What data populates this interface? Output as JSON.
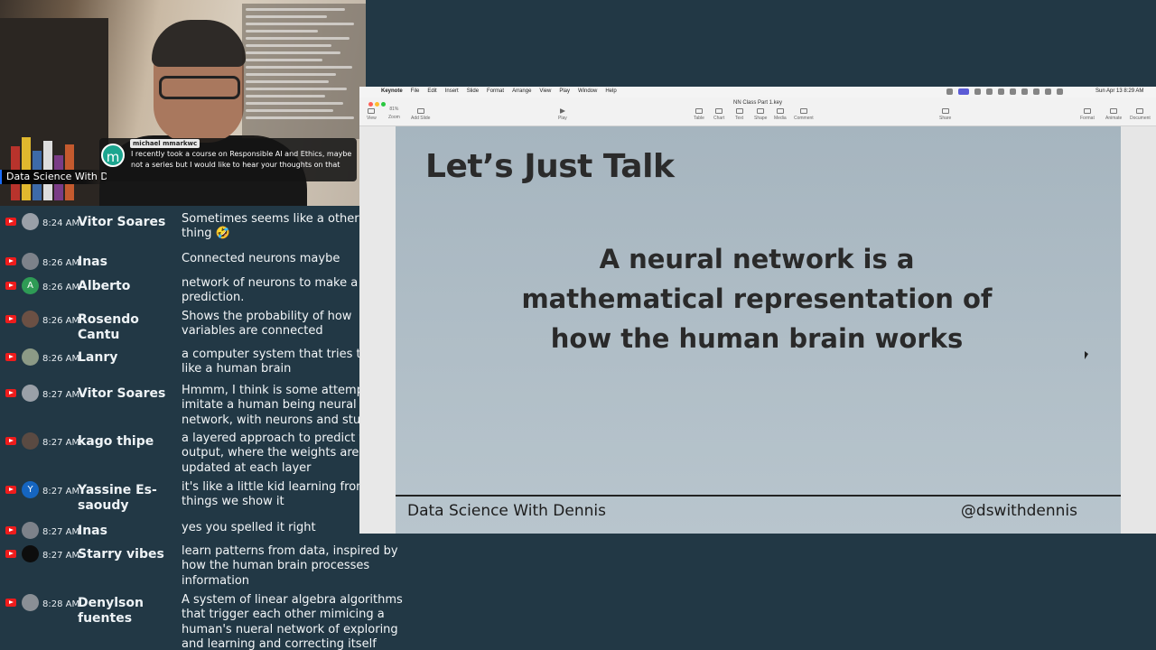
{
  "webcam": {
    "featured_message": {
      "avatar_letter": "m",
      "name": "michael mmarkwc",
      "text": "I recently took a course on Responsible AI and Ethics, maybe not a series but I would like to hear your thoughts on that"
    },
    "channel_banner": "Data Science With De"
  },
  "chat": {
    "messages": [
      {
        "time": "8:24 AM",
        "name": "Vitor Soares",
        "text": "Sometimes seems like a other world thing 🤣",
        "avatar": "",
        "avatar_color": "#9aa0a8"
      },
      {
        "time": "8:26 AM",
        "name": "Inas",
        "text": "Connected neurons maybe",
        "avatar": "",
        "avatar_color": "#7d828a"
      },
      {
        "time": "8:26 AM",
        "name": "Alberto",
        "text": "network of neurons to make a prediction.",
        "avatar": "A",
        "avatar_color": "#2e9b55"
      },
      {
        "time": "8:26 AM",
        "name": "Rosendo Cantu",
        "text": "Shows the probability of how variables are connected",
        "avatar": "",
        "avatar_color": "#6b5044"
      },
      {
        "time": "8:26 AM",
        "name": "Lanry",
        "text": "a computer system that tries to learn like a human brain",
        "avatar": "",
        "avatar_color": "#8c9a86"
      },
      {
        "time": "8:27 AM",
        "name": "Vitor Soares",
        "text": "Hmmm, I think is some attempt to imitate a human being neural network, with neurons and stuffs",
        "avatar": "",
        "avatar_color": "#9aa0a8"
      },
      {
        "time": "8:27 AM",
        "name": "kago thipe",
        "text": "a layered approach to predict the output, where the weights are updated at each layer",
        "avatar": "",
        "avatar_color": "#5a4a42"
      },
      {
        "time": "8:27 AM",
        "name": "Yassine Es-saoudy",
        "text": "it's like a little kid learning from the things we show it",
        "avatar": "Y",
        "avatar_color": "#1565c0"
      },
      {
        "time": "8:27 AM",
        "name": "Inas",
        "text": "yes you spelled it right",
        "avatar": "",
        "avatar_color": "#7d828a"
      },
      {
        "time": "8:27 AM",
        "name": "Starry vibes",
        "text": "learn patterns from data, inspired by how the human brain processes information",
        "avatar": "",
        "avatar_color": "#0d0d0d"
      },
      {
        "time": "8:28 AM",
        "name": "Denylson fuentes",
        "text": "A system of linear algebra algorithms that trigger each other mimicing a human's nueral network of exploring and learning and correcting itself",
        "avatar": "",
        "avatar_color": "#8a8f95"
      }
    ]
  },
  "keynote": {
    "menubar": {
      "items": [
        "Keynote",
        "File",
        "Edit",
        "Insert",
        "Slide",
        "Format",
        "Arrange",
        "View",
        "Play",
        "Window",
        "Help"
      ],
      "clock": "Sun Apr 13  8:29 AM"
    },
    "toolbar": {
      "document_title": "NN Class Part 1.key",
      "zoom": "81%",
      "buttons": [
        "View",
        "Zoom",
        "Add Slide",
        "Play",
        "Table",
        "Chart",
        "Text",
        "Shape",
        "Media",
        "Comment",
        "Share",
        "Format",
        "Animate",
        "Document"
      ]
    },
    "slide": {
      "title": "Let’s Just Talk",
      "body": "A neural network is a mathematical representation of how the human brain works",
      "footer_left": "Data Science With Dennis",
      "footer_right": "@dswithdennis"
    }
  },
  "colors": {
    "background": "#223845",
    "youtube_red": "#ee1c1c",
    "slide_bg": "#b0bec7"
  }
}
